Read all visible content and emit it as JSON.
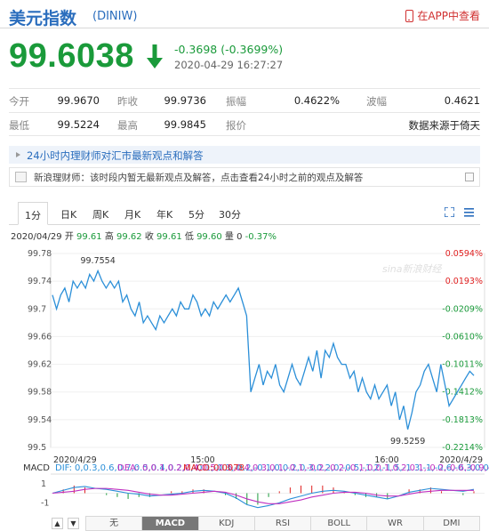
{
  "header": {
    "title": "美元指数",
    "code": "(DINIW)",
    "app_link": "在APP中查看"
  },
  "quote": {
    "price": "99.6038",
    "change": "-0.3698 (-0.3699%)",
    "datetime": "2020-04-29 16:27:27"
  },
  "stats": {
    "row1": [
      {
        "label": "今开",
        "value": "99.9670"
      },
      {
        "label": "昨收",
        "value": "99.9736"
      },
      {
        "label": "振幅",
        "value": "0.4622%"
      },
      {
        "label": "波幅",
        "value": "0.4621"
      }
    ],
    "row2": [
      {
        "label": "最低",
        "value": "99.5224"
      },
      {
        "label": "最高",
        "value": "99.9845"
      },
      {
        "label": "报价",
        "value": "数据来源于倚天"
      }
    ]
  },
  "news": {
    "headline": "24小时内理财师对汇市最新观点和解答",
    "answer": "新浪理财师：该时段内暂无最新观点及解答，点击查看24小时之前的观点及解答"
  },
  "tabs": [
    "1分",
    "日K",
    "周K",
    "月K",
    "年K",
    "5分",
    "30分"
  ],
  "day_quote": {
    "date": "2020/04/29",
    "open_label": "开",
    "open": "99.61",
    "high_label": "高",
    "high": "99.62",
    "close_label": "收",
    "close": "99.61",
    "low_label": "低",
    "low": "99.60",
    "vol_label": "量",
    "vol": "0",
    "pct": "-0.37%"
  },
  "bottom_tabs": [
    "无",
    "MACD",
    "KDJ",
    "RSI",
    "BOLL",
    "WR",
    "DMI"
  ],
  "colors": {
    "up": "#e02020",
    "down": "#1a9a3a",
    "link": "#2a6dbd",
    "line": "#2b8fd8"
  },
  "chart_data": {
    "type": "line",
    "watermark": "sina新浪财经",
    "y_ticks": [
      "99.78",
      "99.74",
      "99.7",
      "99.66",
      "99.62",
      "99.58",
      "99.54",
      "99.5"
    ],
    "y_tick_values": [
      99.78,
      99.74,
      99.7,
      99.66,
      99.62,
      99.58,
      99.54,
      99.5
    ],
    "pct_ticks": [
      "0.0594%",
      "0.0193%",
      "-0.0209%",
      "-0.0610%",
      "-0.1011%",
      "-0.1412%",
      "-0.1813%",
      "-0.2214%"
    ],
    "x_ticks": [
      "2020/4/29",
      "15:00",
      "16:00",
      "2020/4/29"
    ],
    "ylim": [
      99.5,
      99.78
    ],
    "prev_close": 99.9736,
    "annotations": [
      {
        "label": "99.7554",
        "value": 99.7554
      },
      {
        "label": "99.5259",
        "value": 99.5259
      }
    ],
    "series": [
      {
        "values": [
          99.72,
          99.7,
          99.72,
          99.73,
          99.71,
          99.74,
          99.73,
          99.74,
          99.73,
          99.75,
          99.74,
          99.755,
          99.74,
          99.73,
          99.74,
          99.73,
          99.74,
          99.71,
          99.72,
          99.7,
          99.69,
          99.71,
          99.68,
          99.69,
          99.68,
          99.67,
          99.69,
          99.68,
          99.69,
          99.7,
          99.69,
          99.71,
          99.7,
          99.7,
          99.72,
          99.71,
          99.69,
          99.7,
          99.69,
          99.71,
          99.7,
          99.71,
          99.72,
          99.71,
          99.72,
          99.73,
          99.71,
          99.69,
          99.58,
          99.6,
          99.62,
          99.59,
          99.61,
          99.6,
          99.62,
          99.59,
          99.58,
          99.6,
          99.62,
          99.6,
          99.59,
          99.61,
          99.63,
          99.61,
          99.64,
          99.6,
          99.64,
          99.63,
          99.65,
          99.63,
          99.62,
          99.62,
          99.6,
          99.61,
          99.58,
          99.6,
          99.58,
          99.57,
          99.59,
          99.57,
          99.58,
          99.59,
          99.56,
          99.58,
          99.54,
          99.56,
          99.5259,
          99.55,
          99.58,
          99.59,
          99.61,
          99.62,
          99.6,
          99.58,
          99.62,
          99.59,
          99.56,
          99.57,
          99.58,
          99.59,
          99.6,
          99.61,
          99.6038
        ]
      }
    ],
    "macd": {
      "label": "MACD",
      "dif_label": "DIF:",
      "dif": [
        0.0,
        0.3,
        0.6,
        0.7,
        0.5,
        0.4,
        0.2,
        0.0,
        -0.1,
        -0.3,
        -0.2,
        -0.1,
        0.0,
        0.2,
        0.3,
        0.2,
        0.0,
        -0.5,
        -1.2,
        -1.5,
        -1.3,
        -1.0,
        -0.6,
        -0.3,
        0.0,
        0.2,
        0.3,
        0.2,
        0.0,
        -0.2,
        -0.4,
        -0.6,
        -0.3,
        0.1,
        0.3,
        0.5,
        0.4,
        0.3,
        0.2,
        0.4
      ],
      "dea_label": "DEA:",
      "dea": [
        0.0,
        0.1,
        0.2,
        0.4,
        0.5,
        0.5,
        0.4,
        0.3,
        0.1,
        -0.1,
        -0.2,
        -0.2,
        -0.1,
        0.0,
        0.1,
        0.2,
        0.1,
        -0.2,
        -0.6,
        -0.9,
        -1.1,
        -1.1,
        -0.9,
        -0.7,
        -0.4,
        -0.2,
        0.0,
        0.1,
        0.1,
        0.0,
        -0.2,
        -0.3,
        -0.3,
        -0.1,
        0.1,
        0.2,
        0.3,
        0.3,
        0.3,
        0.3
      ],
      "macd_label": "MACD:",
      "macd": "0.0078",
      "y_ticks": [
        "1",
        "-1"
      ]
    }
  }
}
